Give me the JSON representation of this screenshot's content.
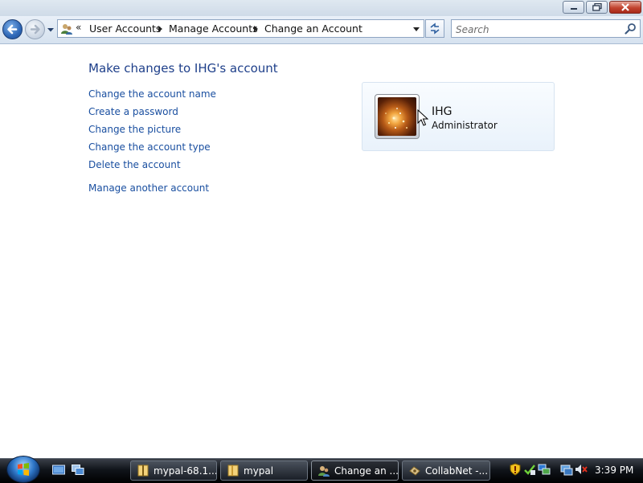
{
  "window": {
    "minimize_icon": "minimize-icon",
    "maximize_icon": "restore-icon",
    "close_icon": "close-icon"
  },
  "navbar": {
    "back_icon": "back-arrow-icon",
    "forward_icon": "forward-arrow-icon",
    "recent_pages_icon": "chevron-down-icon",
    "address_icon": "user-accounts-icon",
    "overflow_glyph": "«",
    "breadcrumbs": [
      "User Accounts",
      "Manage Accounts",
      "Change an Account"
    ],
    "refresh_icon": "refresh-icon",
    "search_placeholder": "Search",
    "search_value": ""
  },
  "content": {
    "title": "Make changes to IHG's account",
    "tasks": [
      "Change the account name",
      "Create a password",
      "Change the picture",
      "Change the account type",
      "Delete the account"
    ],
    "manage_other": "Manage another account",
    "account": {
      "name": "IHG",
      "type": "Administrator",
      "picture_icon": "user-picture-icon"
    }
  },
  "taskbar": {
    "start_icon": "windows-start-icon",
    "quick_launch": [
      "show-desktop-icon",
      "switch-windows-icon"
    ],
    "buttons": [
      {
        "label": "mypal-68.1...",
        "icon": "folder-zip-icon",
        "active": false
      },
      {
        "label": "mypal",
        "icon": "folder-icon",
        "active": false
      },
      {
        "label": "Change an ...",
        "icon": "user-accounts-icon",
        "active": true
      },
      {
        "label": "CollabNet -...",
        "icon": "collabnet-icon",
        "active": false
      }
    ],
    "tray_icons": [
      "security-alert-icon",
      "update-icon",
      "network-icon",
      "volume-muted-icon"
    ],
    "clock": "3:39 PM"
  },
  "colors": {
    "link": "#1a4fa0",
    "title": "#1e3f8a",
    "taskbar": "#10141a"
  }
}
